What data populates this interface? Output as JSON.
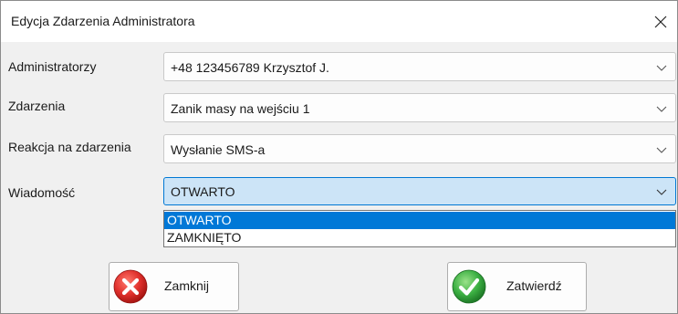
{
  "window": {
    "title": "Edycja Zdarzenia Administratora"
  },
  "fields": [
    {
      "label": "Administratorzy",
      "value": "+48 123456789 Krzysztof J."
    },
    {
      "label": "Zdarzenia",
      "value": "Zanik masy na wejściu 1"
    },
    {
      "label": "Reakcja na zdarzenia",
      "value": "Wysłanie SMS-a"
    },
    {
      "label": "Wiadomość",
      "value": "OTWARTO"
    }
  ],
  "dropdown": {
    "options": [
      "OTWARTO",
      "ZAMKNIĘTO"
    ],
    "selected": "OTWARTO"
  },
  "buttons": {
    "close_label": "Zamknij",
    "confirm_label": "Zatwierdź"
  },
  "colors": {
    "selection": "#0078d7",
    "active_field": "#cce4f7",
    "close_icon_red": "#e0302c",
    "confirm_icon_green": "#3cb043"
  },
  "icons": {
    "window_close": "close-icon",
    "chevrons": "chevron-down-icon",
    "close_button": "red-x-circle-icon",
    "confirm_button": "green-check-circle-icon"
  }
}
